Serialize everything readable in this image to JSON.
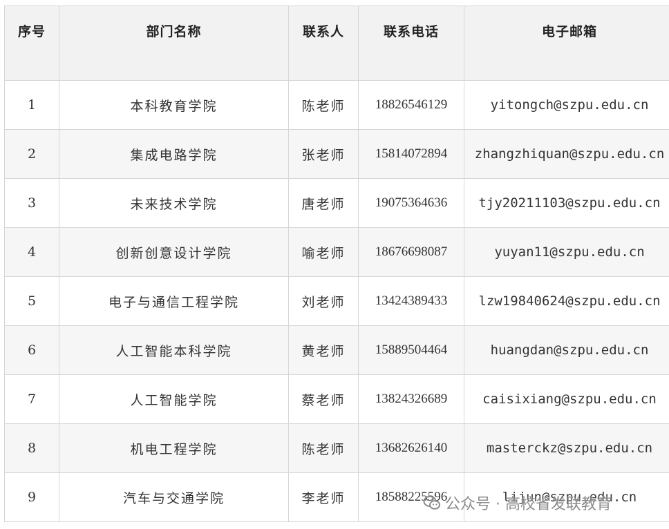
{
  "table": {
    "headers": {
      "index": "序号",
      "department": "部门名称",
      "contact": "联系人",
      "phone": "联系电话",
      "email": "电子邮箱"
    },
    "rows": [
      {
        "index": "1",
        "department": "本科教育学院",
        "contact": "陈老师",
        "phone": "18826546129",
        "email": "yitongch@szpu.edu.cn"
      },
      {
        "index": "2",
        "department": "集成电路学院",
        "contact": "张老师",
        "phone": "15814072894",
        "email": "zhangzhiquan@szpu.edu.cn"
      },
      {
        "index": "3",
        "department": "未来技术学院",
        "contact": "唐老师",
        "phone": "19075364636",
        "email": "tjy20211103@szpu.edu.cn"
      },
      {
        "index": "4",
        "department": "创新创意设计学院",
        "contact": "喻老师",
        "phone": "18676698087",
        "email": "yuyan11@szpu.edu.cn"
      },
      {
        "index": "5",
        "department": "电子与通信工程学院",
        "contact": "刘老师",
        "phone": "13424389433",
        "email": "lzw19840624@szpu.edu.cn"
      },
      {
        "index": "6",
        "department": "人工智能本科学院",
        "contact": "黄老师",
        "phone": "15889504464",
        "email": "huangdan@szpu.edu.cn"
      },
      {
        "index": "7",
        "department": "人工智能学院",
        "contact": "蔡老师",
        "phone": "13824326689",
        "email": "caisixiang@szpu.edu.cn"
      },
      {
        "index": "8",
        "department": "机电工程学院",
        "contact": "陈老师",
        "phone": "13682626140",
        "email": "masterckz@szpu.edu.cn"
      },
      {
        "index": "9",
        "department": "汽车与交通学院",
        "contact": "李老师",
        "phone": "18588225596",
        "email": "lijun@szpu.edu.cn"
      }
    ]
  },
  "watermark": {
    "text": "公众号 · 高校省发联教育",
    "icon": "wechat-official-account-icon"
  }
}
